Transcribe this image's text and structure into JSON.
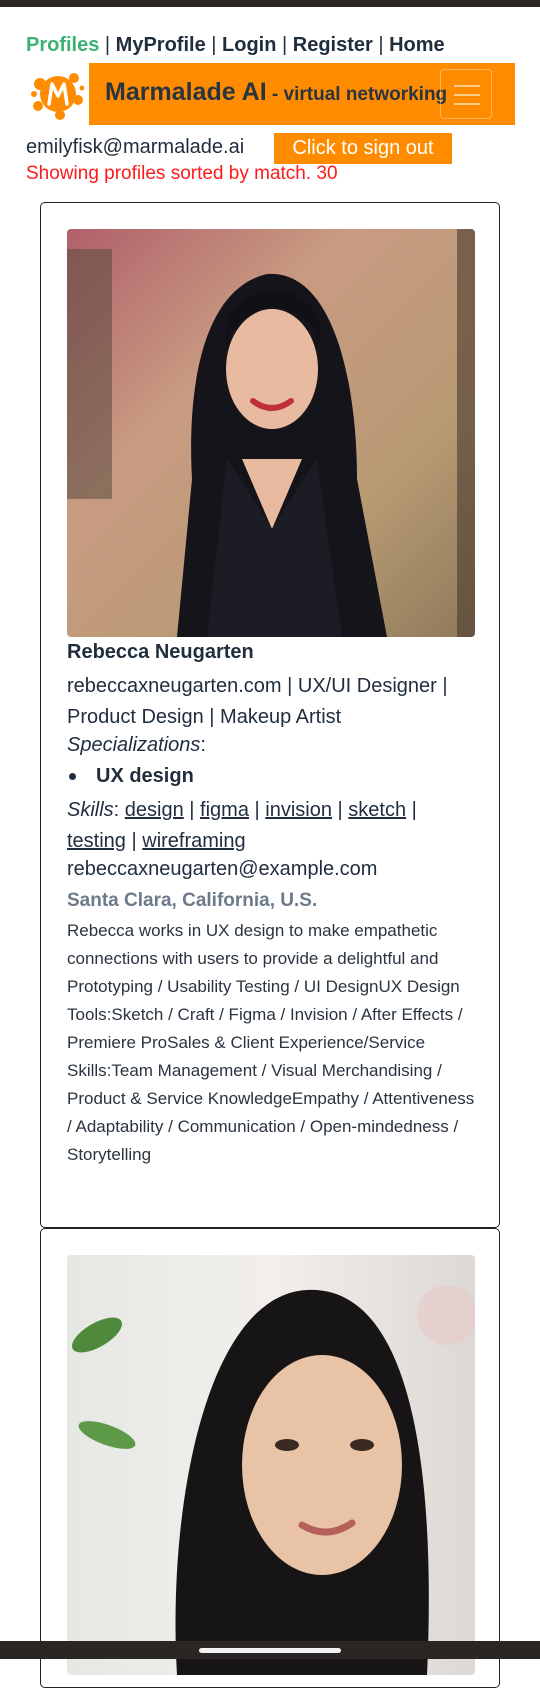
{
  "nav": {
    "items": [
      {
        "label": "Profiles",
        "active": true
      },
      {
        "label": "MyProfile",
        "active": false
      },
      {
        "label": "Login",
        "active": false
      },
      {
        "label": "Register",
        "active": false
      },
      {
        "label": "Home",
        "active": false
      }
    ],
    "separator": " | "
  },
  "header": {
    "brand": "Marmalade AI",
    "tagline": " - virtual networking",
    "logo_icon": "marmalade-splash-logo",
    "menu_icon": "hamburger-menu-icon"
  },
  "session": {
    "email": "emilyfisk@marmalade.ai",
    "signout_label": "Click to sign out"
  },
  "sort_message": "Showing profiles sorted by match. 30",
  "profiles": [
    {
      "name": "Rebecca Neugarten",
      "headline": "rebeccaxneugarten.com | UX/UI Designer | Product Design | Makeup Artist",
      "specializations_label": "Specializations",
      "specializations": [
        "UX design"
      ],
      "skills_label": "Skills",
      "skills": [
        "design",
        "figma",
        "invision",
        "sketch",
        "testing",
        "wireframing"
      ],
      "email": "rebeccaxneugarten@example.com",
      "location": "Santa Clara, California, U.S.",
      "bio": "Rebecca works in UX design to make empathetic connections with users to provide a delightful and Prototyping / Usability Testing / UI DesignUX Design Tools:Sketch / Craft / Figma / Invision / After Effects / Premiere ProSales & Client Experience/Service Skills:Team Management / Visual Merchandising / Product & Service KnowledgeEmpathy / Attentiveness / Adaptability / Communication / Open-mindedness / Storytelling"
    }
  ],
  "colors": {
    "accent": "#ff8c00",
    "active_nav": "#3bb273",
    "alert": "#ff1a1a",
    "text": "#1f2d3d"
  }
}
